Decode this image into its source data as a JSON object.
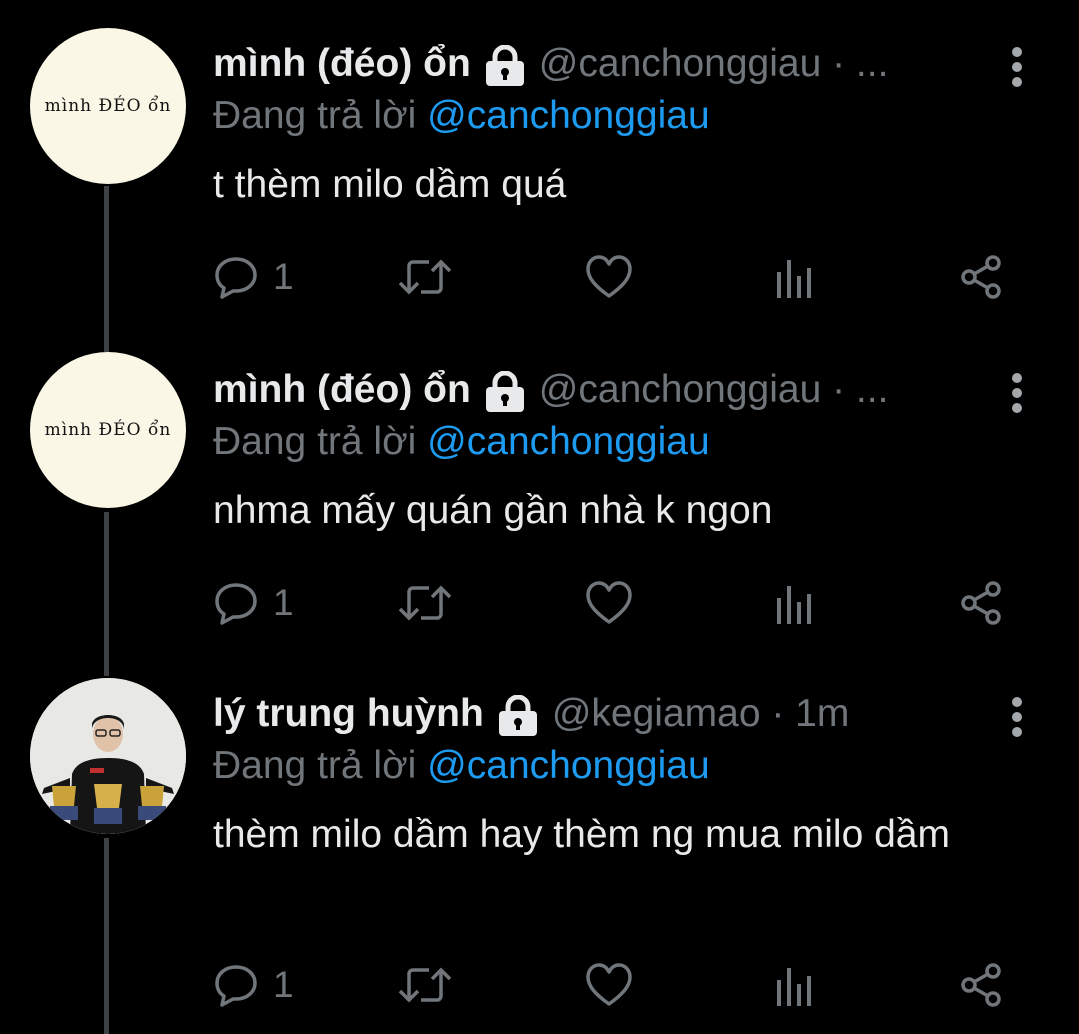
{
  "tweets": [
    {
      "name": "mình (đéo) ổn",
      "handle": "@canchonggiau · ...",
      "reply_prefix": "Đang trả lời",
      "reply_mention": "@canchonggiau",
      "text": "t thèm milo dầm quá",
      "reply_count": "1",
      "avatar_text": "mình ĐÉO ổn"
    },
    {
      "name": "mình (đéo) ổn",
      "handle": "@canchonggiau · ...",
      "reply_prefix": "Đang trả lời",
      "reply_mention": "@canchonggiau",
      "text": "nhma mấy quán gần nhà k ngon",
      "reply_count": "1",
      "avatar_text": "mình ĐÉO ổn"
    },
    {
      "name": "lý trung huỳnh",
      "handle": "@kegiamao · 1m",
      "reply_prefix": "Đang trả lời",
      "reply_mention": "@canchonggiau",
      "text": "thèm milo dầm hay thèm ng mua milo dầm",
      "reply_count": "1",
      "avatar_text": ""
    }
  ],
  "icons": {
    "lock": "lock-icon",
    "more": "more-vertical-icon",
    "reply": "reply-icon",
    "retweet": "retweet-icon",
    "like": "heart-icon",
    "views": "bar-chart-icon",
    "share": "share-icon"
  },
  "colors": {
    "background": "#000000",
    "text": "#e7e9ea",
    "secondary": "#71767b",
    "mention": "#1d9bf0",
    "thread_line": "#3e4144"
  }
}
